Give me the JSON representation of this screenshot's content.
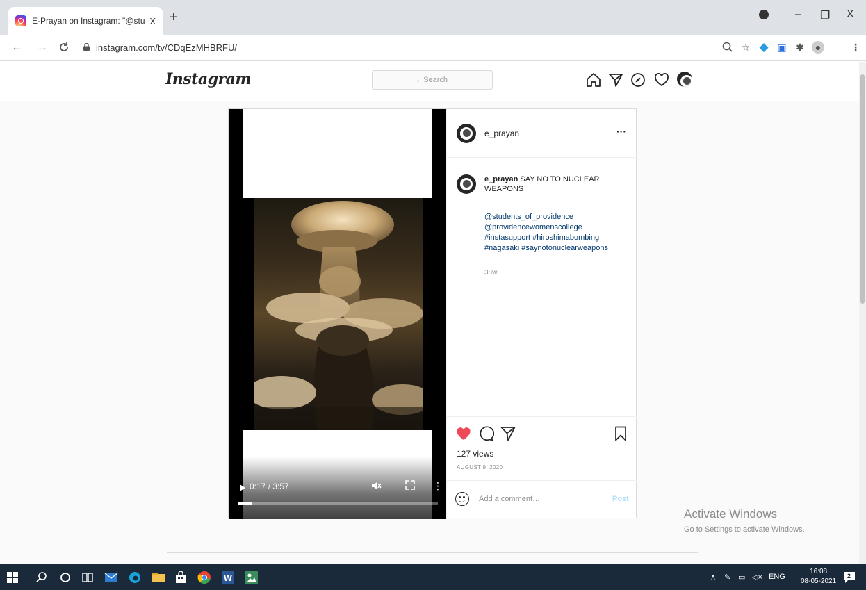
{
  "browser": {
    "tab_title": "E-Prayan on Instagram: \"@stude",
    "tab_close": "X",
    "new_tab": "+",
    "url": "instagram.com/tv/CDqEzMHBRFU/",
    "win_min": "–",
    "win_restore": "❐",
    "win_close": "X"
  },
  "header": {
    "logo": "Instagram",
    "search_placeholder": "Search"
  },
  "video": {
    "time": "0:17 / 3:57",
    "progress": 0.07
  },
  "post": {
    "username": "e_prayan",
    "more": "···",
    "caption_user": "e_prayan",
    "caption_text": " SAY NO TO NUCLEAR WEAPONS",
    "hashtags": [
      "@students_of_providence",
      "@providencewomenscollege",
      "#instasupport #hiroshimabombing",
      "#nagasaki #saynotonuclearweapons"
    ],
    "ago": "38w",
    "views": "127 views",
    "date": "AUGUST 9, 2020",
    "comment_placeholder": "Add a comment…",
    "post_button": "Post"
  },
  "watermark": {
    "title": "Activate Windows",
    "subtitle": "Go to Settings to activate Windows."
  },
  "taskbar": {
    "lang": "ENG",
    "time": "16:08",
    "date": "08-05-2021",
    "notif_count": "2"
  },
  "colors": {
    "heart": "#ed4956",
    "link": "#00376b",
    "taskbar": "#1b2a3a"
  }
}
